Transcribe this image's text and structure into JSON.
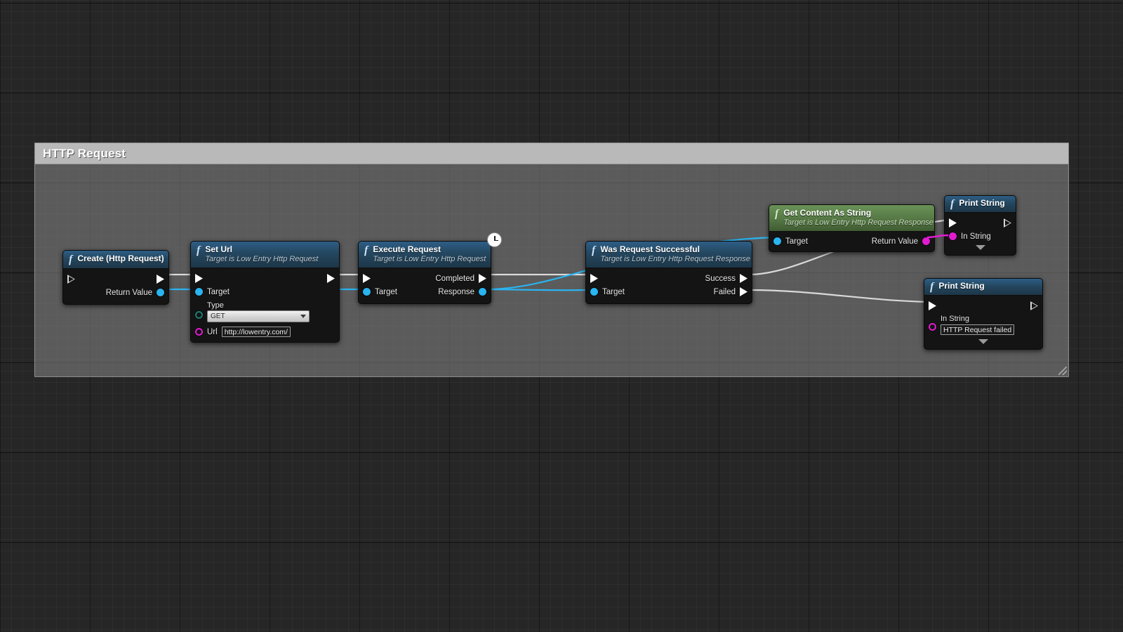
{
  "graph": {
    "background_color": "#262626",
    "grid_minor_color": "#2e2e2e",
    "grid_major_color": "#151515"
  },
  "comment": {
    "title": "HTTP Request",
    "fill_color": "#7e7e7e",
    "header_color": "#b9b9b9"
  },
  "colors": {
    "exec_wire": "#d9d9d9",
    "object_wire": "#2ab4f0",
    "string_wire": "#e21bd0",
    "node_header_blue": "#2e5e86",
    "node_header_green": "#6a9257",
    "node_body": "#141414"
  },
  "nodes": [
    {
      "id": "create-http-request",
      "title": "Create (Http Request)",
      "subtitle": "",
      "kind": "function",
      "pins": {
        "exec_in_label": "",
        "exec_out_label": "",
        "return_value_label": "Return Value"
      }
    },
    {
      "id": "set-url",
      "title": "Set Url",
      "subtitle": "Target is Low Entry Http Request",
      "kind": "function",
      "pins": {
        "target_label": "Target",
        "type_label": "Type",
        "type_value": "GET",
        "url_label": "Url",
        "url_value": "http://lowentry.com/"
      }
    },
    {
      "id": "execute-request",
      "title": "Execute Request",
      "subtitle": "Target is Low Entry Http Request",
      "kind": "latent",
      "badge": "clock-icon",
      "pins": {
        "target_label": "Target",
        "completed_label": "Completed",
        "response_label": "Response"
      }
    },
    {
      "id": "was-request-successful",
      "title": "Was Request Successful",
      "subtitle": "Target is Low Entry Http Request Response",
      "kind": "function",
      "pins": {
        "target_label": "Target",
        "success_label": "Success",
        "failed_label": "Failed"
      }
    },
    {
      "id": "get-content-as-string",
      "title": "Get Content As String",
      "subtitle": "Target is Low Entry Http Request Response",
      "kind": "pure",
      "pins": {
        "target_label": "Target",
        "return_value_label": "Return Value"
      }
    },
    {
      "id": "print-string-success",
      "title": "Print String",
      "subtitle": "",
      "kind": "function",
      "pins": {
        "in_string_label": "In String",
        "in_string_value": ""
      }
    },
    {
      "id": "print-string-failed",
      "title": "Print String",
      "subtitle": "",
      "kind": "function",
      "pins": {
        "in_string_label": "In String",
        "in_string_value": "HTTP Request failed"
      }
    }
  ]
}
